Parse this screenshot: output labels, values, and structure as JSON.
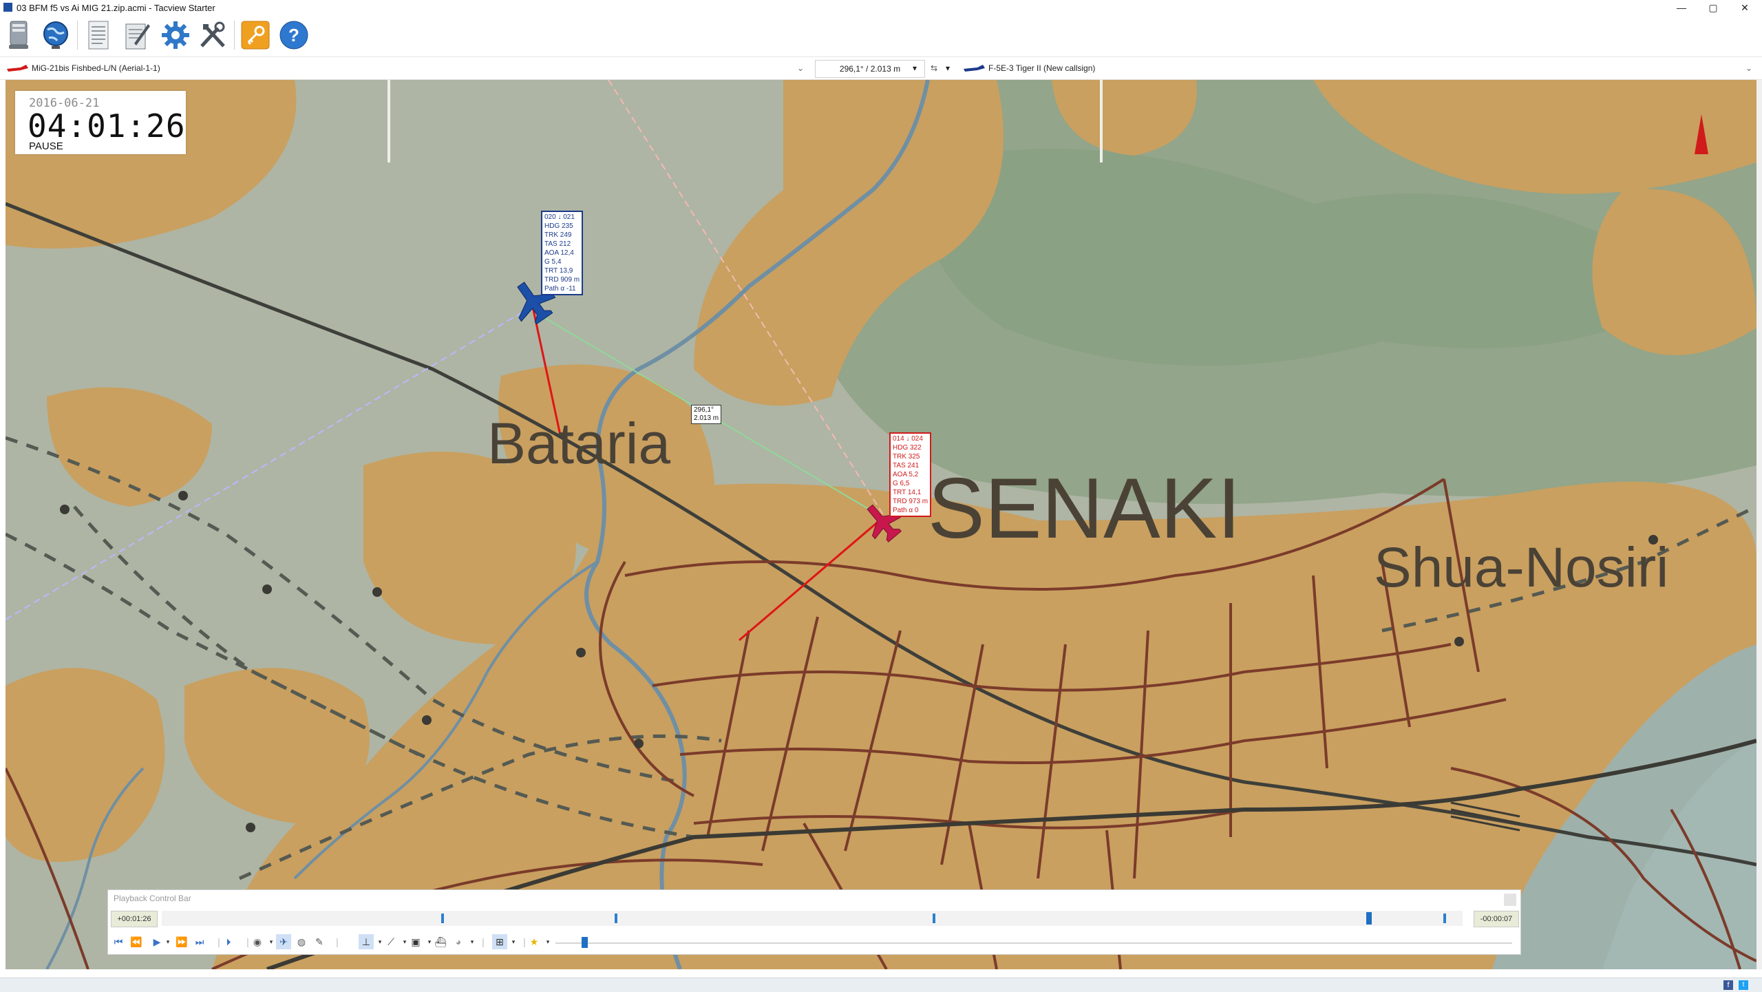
{
  "window": {
    "title": "03 BFM f5 vs Ai MIG 21.zip.acmi - Tacview Starter",
    "controls": [
      "—",
      "▢",
      "✕"
    ]
  },
  "toolbar": {
    "buttons": [
      "drive-icon",
      "globe-icon",
      "document-icon",
      "notepad-icon",
      "gear-icon",
      "tools-icon",
      "key-icon",
      "help-icon"
    ]
  },
  "selection": {
    "primary_object": "MiG-21bis Fishbed-L/N (Aerial-1-1)",
    "distance": "296,1° / 2.013 m",
    "secondary_object": "F-5E-3 Tiger II (New callsign)"
  },
  "clock": {
    "date": "2016-06-21",
    "time": "04:01:26",
    "state": "PAUSE"
  },
  "blue_label": {
    "lines": [
      "020 ↓ 021",
      "HDG 235",
      "TRK 249",
      "TAS 212",
      "AOA 12,4",
      "G 5,4",
      "TRT 13,9",
      "TRD 909 m",
      "Path α -11"
    ]
  },
  "red_label": {
    "lines": [
      "014 ↓ 024",
      "HDG 322",
      "TRK 325",
      "TAS 241",
      "AOA 5,2",
      "G 6,5",
      "TRT 14,1",
      "TRD 973 m",
      "Path α 0"
    ]
  },
  "range_label": {
    "line1": "296,1°",
    "line2": "2.013 m"
  },
  "map_labels": {
    "town1": "Bataria",
    "town2": "SENAKI",
    "town3": "Shua-Nosiri"
  },
  "playback": {
    "title": "Playback Control Bar",
    "elapsed": "+00:01:26",
    "remaining": "-00:00:07",
    "position_fraction": 0.93
  },
  "colors": {
    "blue": "#1c3a8a",
    "red": "#d11a1a",
    "land_green": "#9aa88e",
    "urban": "#c9a060",
    "road": "#7b3b2a"
  }
}
